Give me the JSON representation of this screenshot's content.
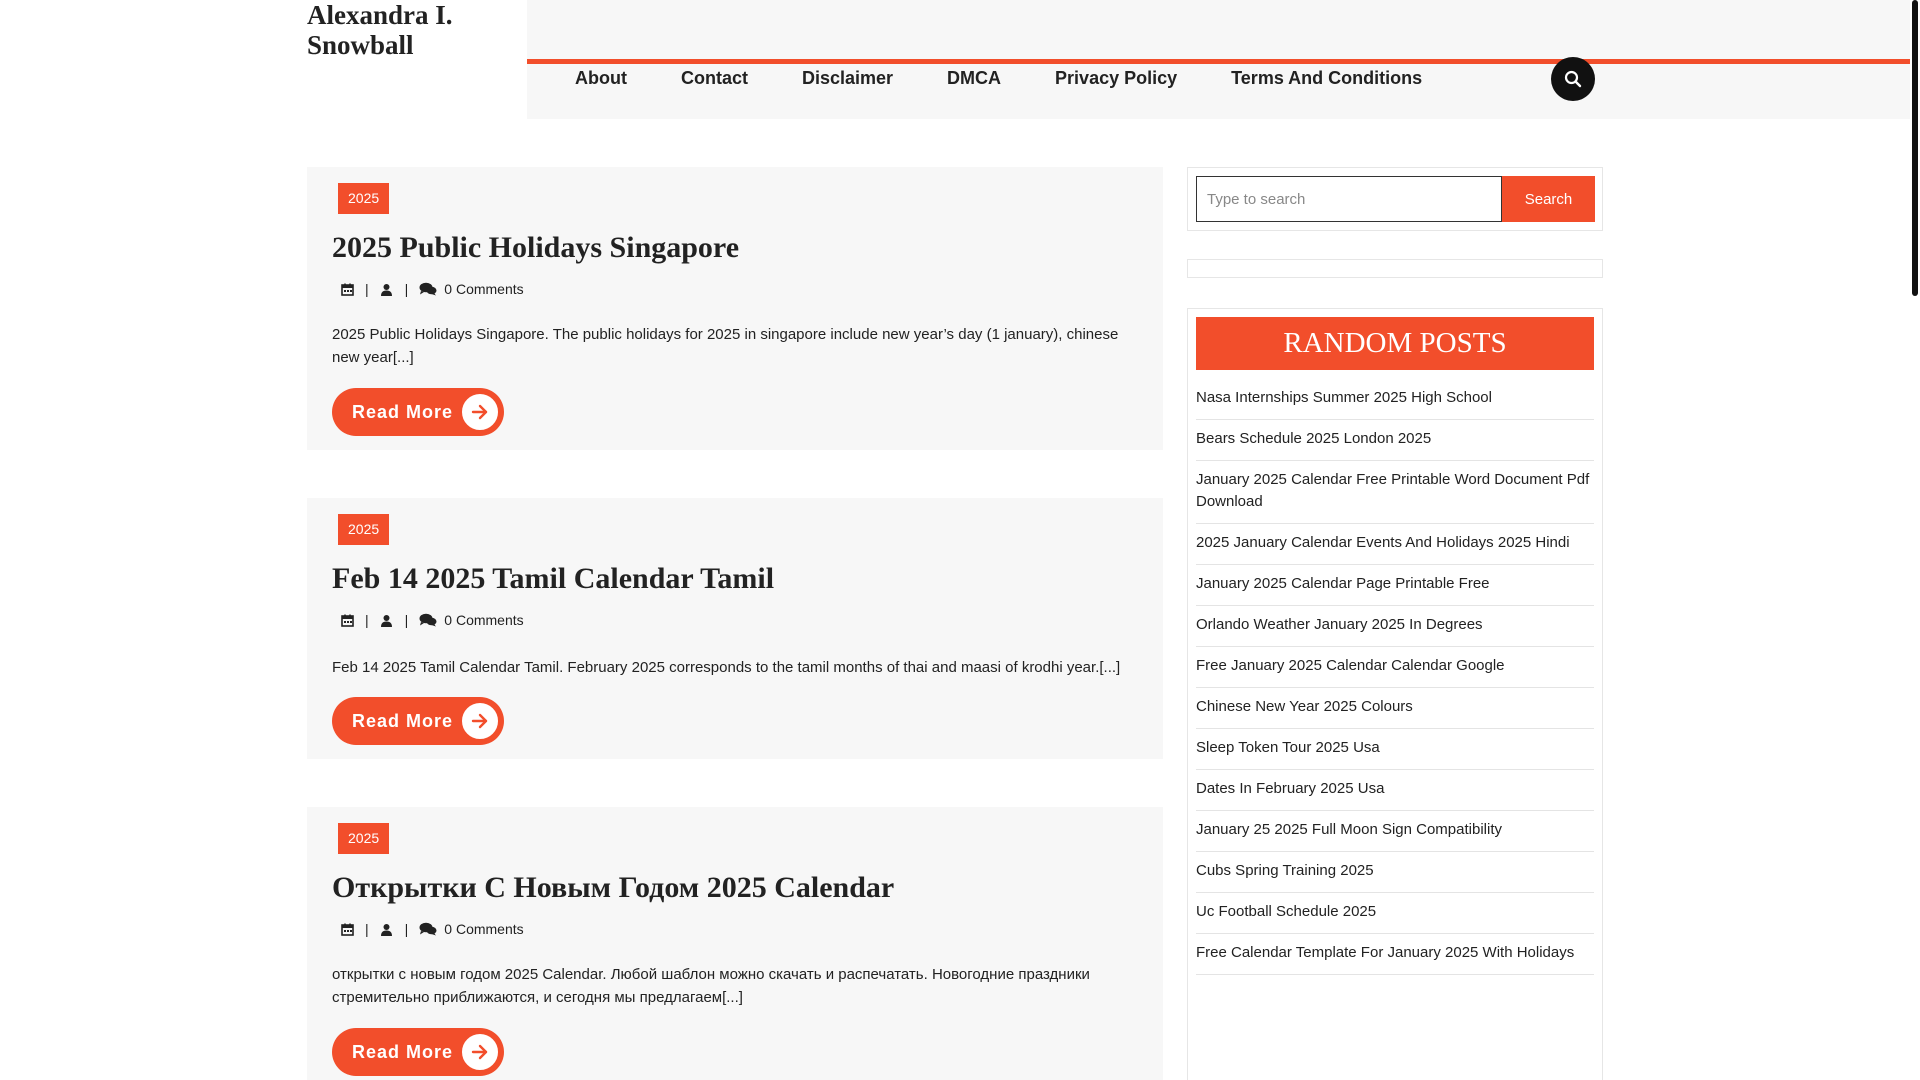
{
  "site": {
    "title": "Alexandra I. Snowball"
  },
  "nav": {
    "items": [
      "About",
      "Contact",
      "Disclaimer",
      "DMCA",
      "Privacy Policy",
      "Terms And Conditions"
    ],
    "search_icon": "search-icon"
  },
  "posts": [
    {
      "category": "2025",
      "title": "2025 Public Holidays Singapore",
      "comments": "0 Comments",
      "excerpt": "2025 Public Holidays Singapore. The public holidays for 2025 in singapore include new year’s day (1 january), chinese new year[...]",
      "read_more": "Read More"
    },
    {
      "category": "2025",
      "title": "Feb 14 2025 Tamil Calendar Tamil",
      "comments": "0 Comments",
      "excerpt": "Feb 14 2025 Tamil Calendar Tamil. February 2025 corresponds to the tamil months of thai and maasi of krodhi year.[...]",
      "read_more": "Read More"
    },
    {
      "category": "2025",
      "title": "Открытки С Новым Годом 2025 Calendar",
      "comments": "0 Comments",
      "excerpt": "открытки с новым годом 2025 Calendar. Любой шаблон можно скачать и распечатать. Новогодние праздники стремительно приближаются, и сегодня мы предлагаем[...]",
      "read_more": "Read More"
    }
  ],
  "sidebar": {
    "search": {
      "placeholder": "Type to search",
      "button": "Search"
    },
    "random_posts": {
      "title": "RANDOM POSTS",
      "items": [
        "Nasa Internships Summer 2025 High School",
        "Bears Schedule 2025 London 2025",
        "January 2025 Calendar Free Printable Word Document Pdf Download",
        "2025 January Calendar Events And Holidays 2025 Hindi",
        "January 2025 Calendar Page Printable Free",
        "Orlando Weather January 2025 In Degrees",
        "Free January 2025 Calendar Calendar Google",
        "Chinese New Year 2025 Colours",
        "Sleep Token Tour 2025 Usa",
        "Dates In February 2025 Usa",
        "January 25 2025 Full Moon Sign Compatibility",
        "Cubs Spring Training 2025",
        "Uc Football Schedule 2025",
        "Free Calendar Template For January 2025 With Holidays"
      ]
    }
  },
  "colors": {
    "accent": "#f24e2b",
    "panel": "#f7f7f7",
    "text": "#222222"
  }
}
